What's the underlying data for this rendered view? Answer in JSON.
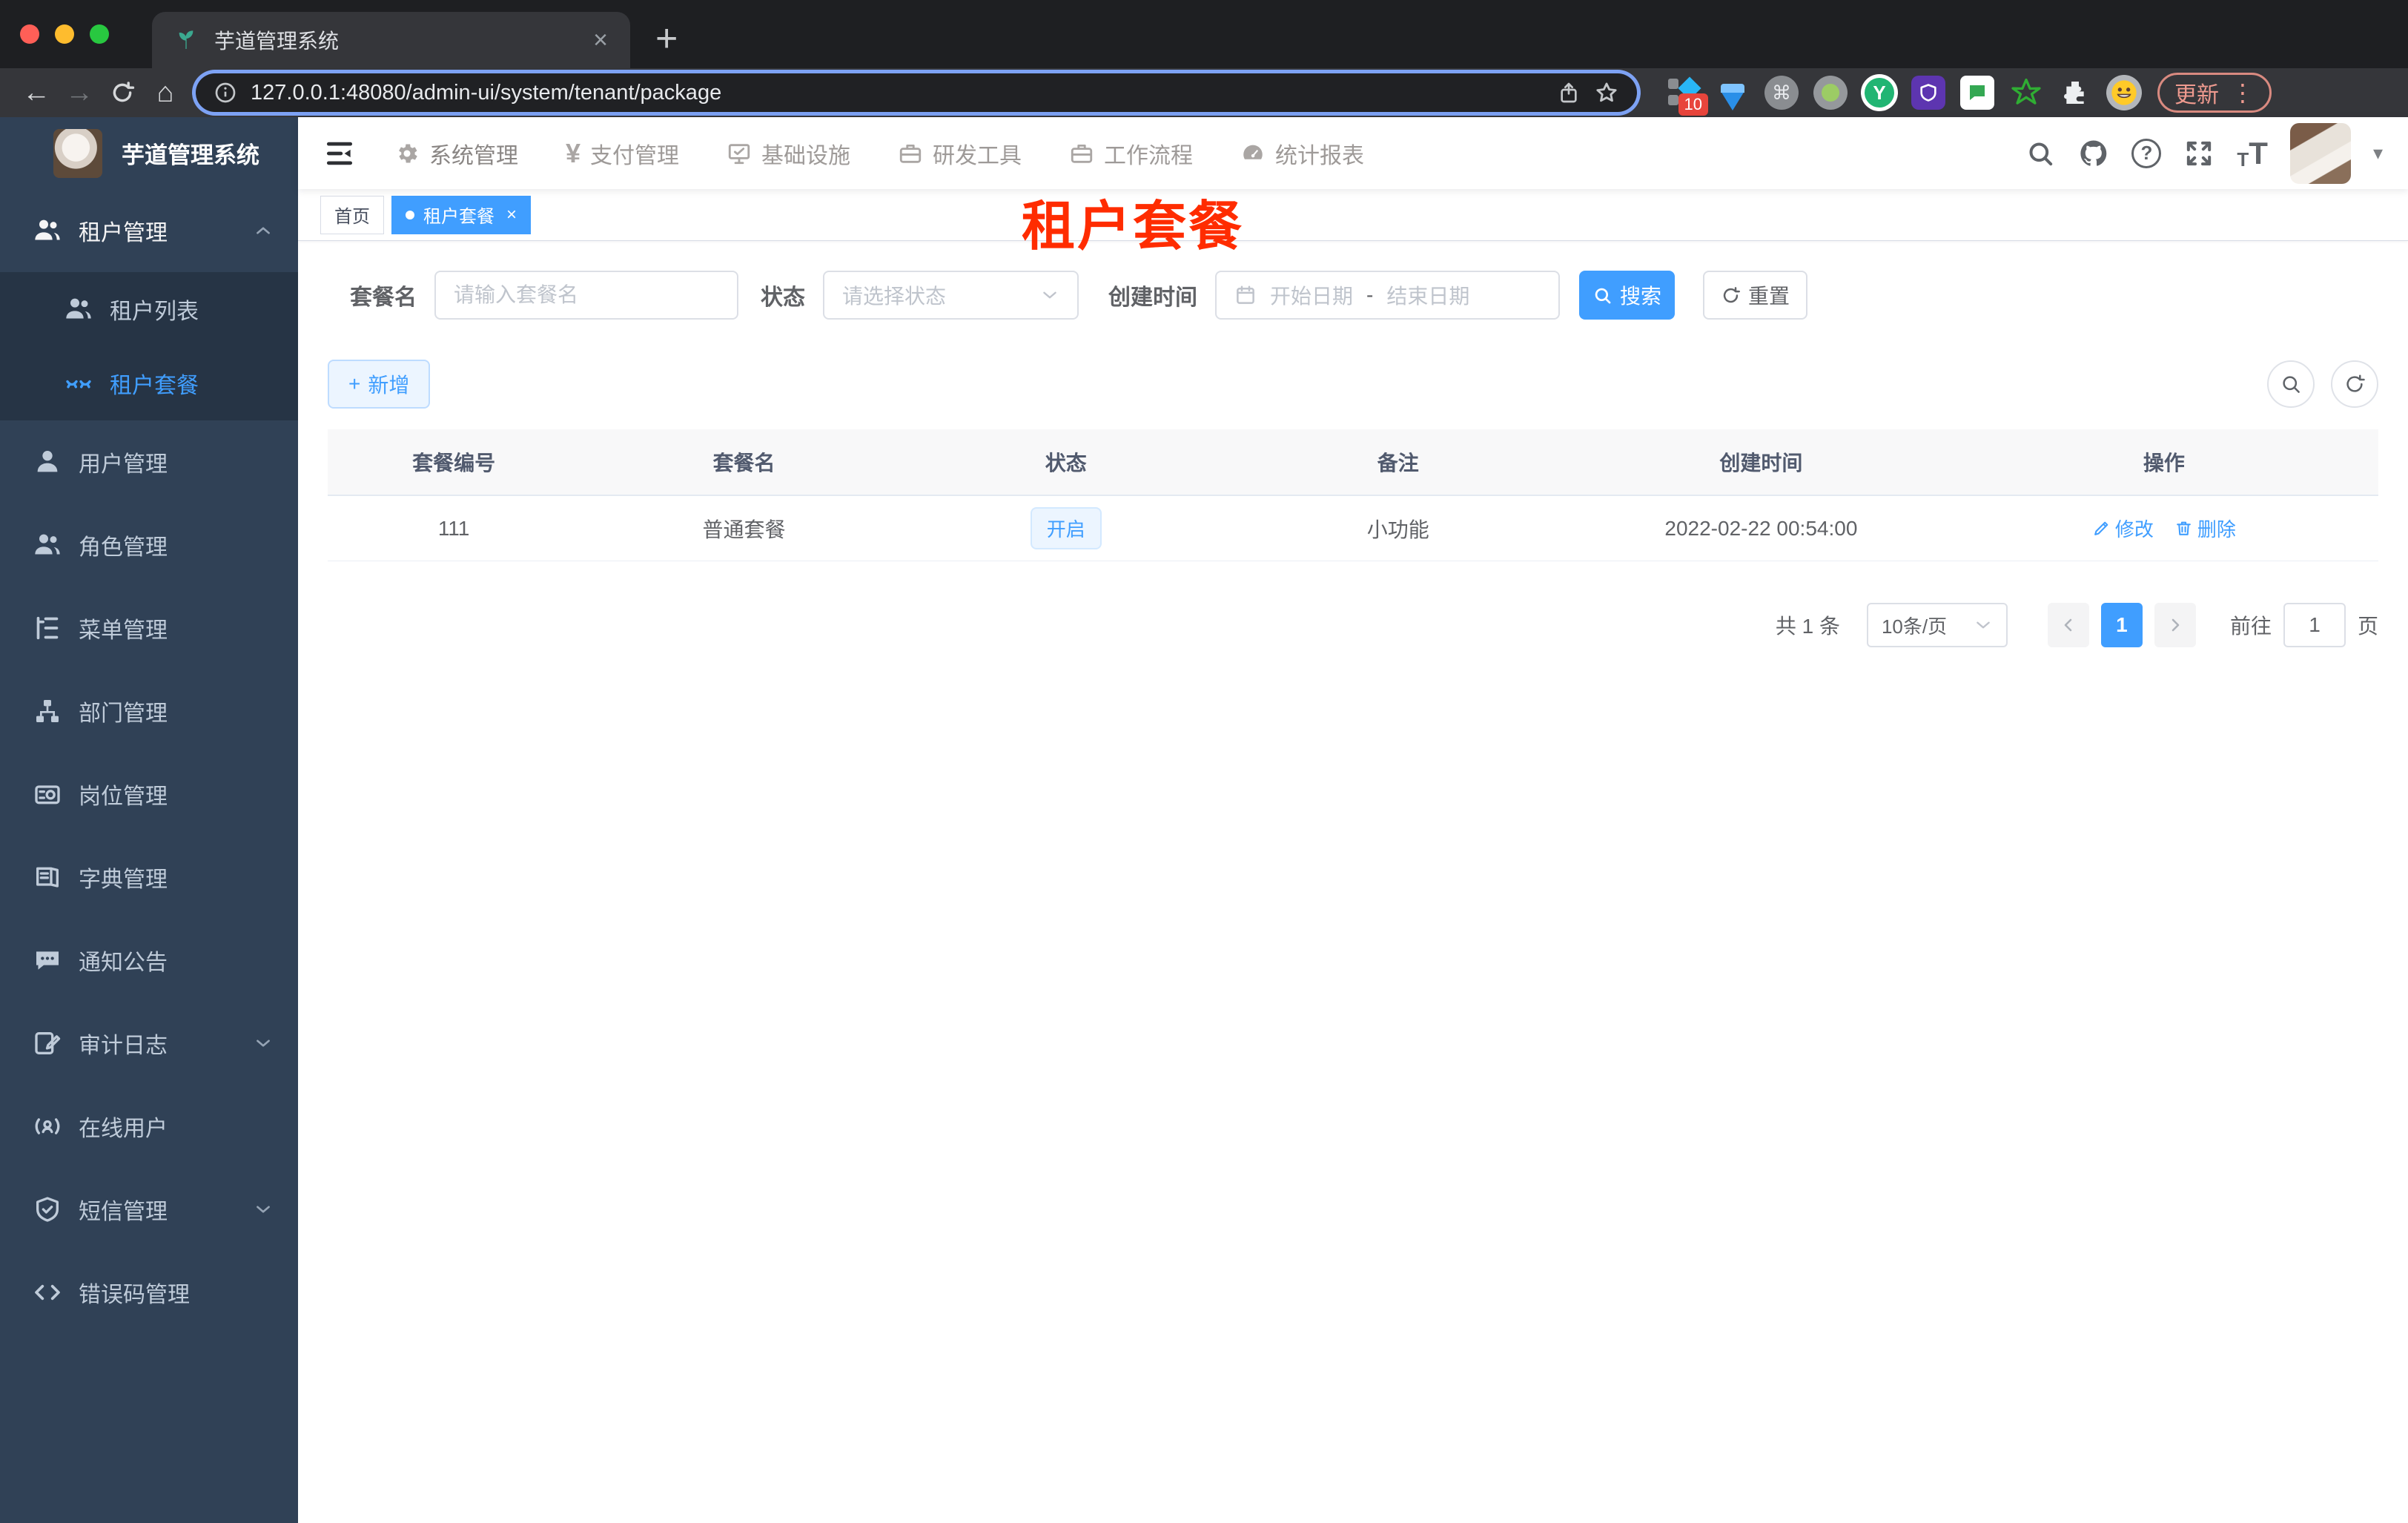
{
  "browser": {
    "tab_title": "芋道管理系统",
    "url": "127.0.0.1:48080/admin-ui/system/tenant/package",
    "extension_badge": "10",
    "update_label": "更新"
  },
  "icons": {
    "back": "←",
    "forward": "→",
    "home": "⌂",
    "plus": "+",
    "close": "×",
    "command": "⌘",
    "question": "?",
    "more_vertical": "⋮",
    "caret_down": "▾",
    "yen": "¥",
    "font_large": "T",
    "font_small": "T",
    "ext_y": "Y"
  },
  "sidebar": {
    "title": "芋道管理系统",
    "menu": [
      {
        "label": "租户管理"
      },
      {
        "label": "租户列表"
      },
      {
        "label": "租户套餐"
      },
      {
        "label": "用户管理"
      },
      {
        "label": "角色管理"
      },
      {
        "label": "菜单管理"
      },
      {
        "label": "部门管理"
      },
      {
        "label": "岗位管理"
      },
      {
        "label": "字典管理"
      },
      {
        "label": "通知公告"
      },
      {
        "label": "审计日志"
      },
      {
        "label": "在线用户"
      },
      {
        "label": "短信管理"
      },
      {
        "label": "错误码管理"
      }
    ]
  },
  "header": {
    "nav": [
      {
        "label": "系统管理"
      },
      {
        "label": "支付管理"
      },
      {
        "label": "基础设施"
      },
      {
        "label": "研发工具"
      },
      {
        "label": "工作流程"
      },
      {
        "label": "统计报表"
      }
    ]
  },
  "tags": {
    "home": "首页",
    "active": "租户套餐"
  },
  "page_title_overlay": "租户套餐",
  "filters": {
    "name_label": "套餐名",
    "name_placeholder": "请输入套餐名",
    "status_label": "状态",
    "status_placeholder": "请选择状态",
    "date_label": "创建时间",
    "date_start_placeholder": "开始日期",
    "date_separator": "-",
    "date_end_placeholder": "结束日期",
    "search_label": "搜索",
    "reset_label": "重置",
    "add_label": "新增"
  },
  "table": {
    "headers": [
      "套餐编号",
      "套餐名",
      "状态",
      "备注",
      "创建时间",
      "操作"
    ],
    "rows": [
      {
        "id": "111",
        "name": "普通套餐",
        "status": "开启",
        "remark": "小功能",
        "created_at": "2022-02-22 00:54:00",
        "edit_label": "修改",
        "delete_label": "删除"
      }
    ]
  },
  "pagination": {
    "total": "共 1 条",
    "page_size": "10条/页",
    "current_page": "1",
    "goto_label": "前往",
    "goto_value": "1",
    "unit_label": "页"
  },
  "colors": {
    "primary": "#409eff",
    "sidebar_bg": "#304156",
    "overlay_red": "#ff2c00"
  }
}
